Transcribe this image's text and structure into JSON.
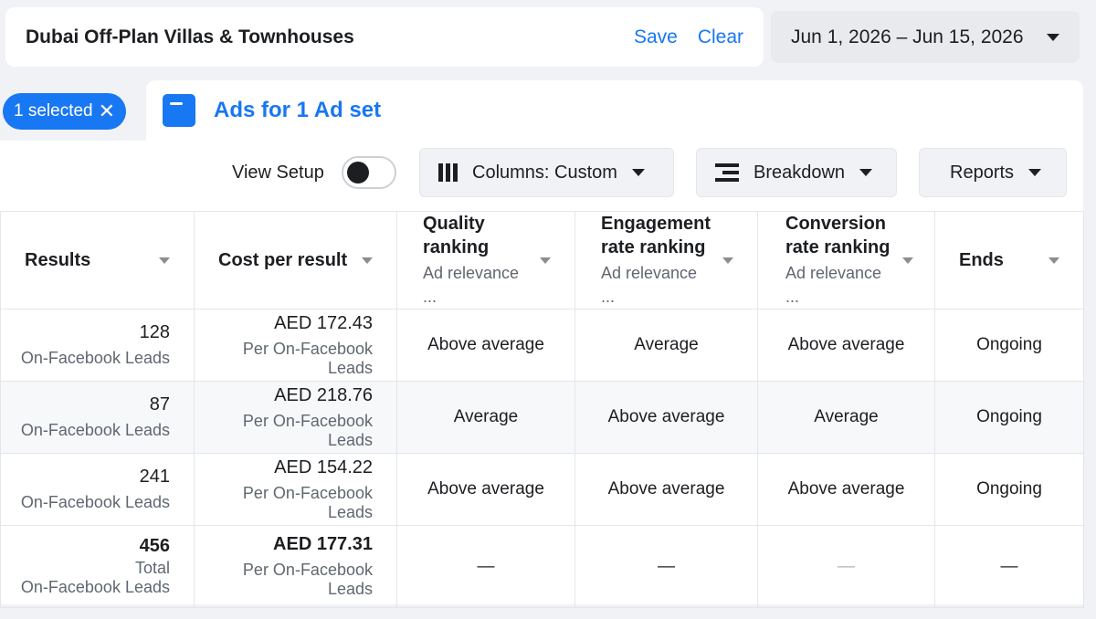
{
  "header": {
    "campaign_title": "Dubai Off-Plan Villas & Townhouses",
    "save_label": "Save",
    "clear_label": "Clear",
    "date_range": "Jun 1, 2026 – Jun 15, 2026"
  },
  "selection": {
    "chip_label": "1 selected",
    "close_glyph": "✕"
  },
  "adset": {
    "title": "Ads for 1 Ad set"
  },
  "toolbar": {
    "view_setup_label": "View Setup",
    "columns_label": "Columns: Custom",
    "breakdown_label": "Breakdown",
    "reports_label": "Reports"
  },
  "table": {
    "columns": [
      {
        "title": "Results",
        "sub": ""
      },
      {
        "title": "Cost per result",
        "sub": ""
      },
      {
        "title": "Quality ranking",
        "sub": "Ad relevance ..."
      },
      {
        "title": "Engagement rate ranking",
        "sub": "Ad relevance ..."
      },
      {
        "title": "Conversion rate ranking",
        "sub": "Ad relevance ..."
      },
      {
        "title": "Ends",
        "sub": ""
      }
    ],
    "rows": [
      {
        "results": "128",
        "results_sub": "On-Facebook Leads",
        "cost": "AED 172.43",
        "cost_sub": "Per On-Facebook Leads",
        "quality": "Above average",
        "engagement": "Average",
        "conversion": "Above average",
        "ends": "Ongoing"
      },
      {
        "results": "87",
        "results_sub": "On-Facebook Leads",
        "cost": "AED 218.76",
        "cost_sub": "Per On-Facebook Leads",
        "quality": "Average",
        "engagement": "Above average",
        "conversion": "Average",
        "ends": "Ongoing"
      },
      {
        "results": "241",
        "results_sub": "On-Facebook Leads",
        "cost": "AED 154.22",
        "cost_sub": "Per On-Facebook Leads",
        "quality": "Above average",
        "engagement": "Above average",
        "conversion": "Above average",
        "ends": "Ongoing"
      }
    ],
    "total": {
      "results": "456",
      "results_sub_line1": "Total",
      "results_sub_line2": "On-Facebook Leads",
      "cost": "AED 177.31",
      "cost_sub": "Per On-Facebook Leads",
      "quality": "—",
      "engagement": "—",
      "conversion": "—",
      "ends": "—"
    }
  },
  "colors": {
    "accent": "#1877f2",
    "background": "#f0f2f5",
    "text": "#1c1e21",
    "muted": "#606770"
  }
}
